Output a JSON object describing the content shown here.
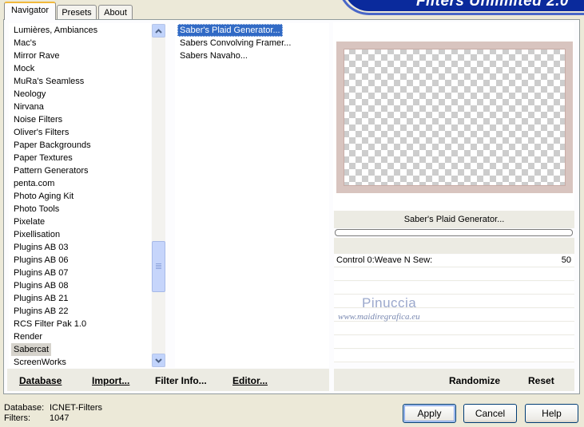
{
  "tabs": [
    {
      "label": "Navigator",
      "active": true
    },
    {
      "label": "Presets",
      "active": false
    },
    {
      "label": "About",
      "active": false
    }
  ],
  "banner": {
    "title": "Filters Unlimited 2.0"
  },
  "categories": [
    {
      "label": "Lumières, Ambiances"
    },
    {
      "label": "Mac's"
    },
    {
      "label": "Mirror Rave"
    },
    {
      "label": "Mock"
    },
    {
      "label": "MuRa's Seamless"
    },
    {
      "label": "Neology"
    },
    {
      "label": "Nirvana"
    },
    {
      "label": "Noise Filters"
    },
    {
      "label": "Oliver's Filters"
    },
    {
      "label": "Paper Backgrounds"
    },
    {
      "label": "Paper Textures"
    },
    {
      "label": "Pattern Generators"
    },
    {
      "label": "penta.com"
    },
    {
      "label": "Photo Aging Kit"
    },
    {
      "label": "Photo Tools"
    },
    {
      "label": "Pixelate"
    },
    {
      "label": "Pixellisation"
    },
    {
      "label": "Plugins AB 03"
    },
    {
      "label": "Plugins AB 06"
    },
    {
      "label": "Plugins AB 07"
    },
    {
      "label": "Plugins AB 08"
    },
    {
      "label": "Plugins AB 21"
    },
    {
      "label": "Plugins AB 22"
    },
    {
      "label": "RCS Filter Pak 1.0"
    },
    {
      "label": "Render"
    },
    {
      "label": "Sabercat",
      "selected": true
    },
    {
      "label": "ScreenWorks"
    }
  ],
  "filters": [
    {
      "label": "Saber's Plaid Generator...",
      "selected": true
    },
    {
      "label": "Sabers Convolving Framer..."
    },
    {
      "label": "Sabers Navaho..."
    }
  ],
  "preview": {
    "filter_name": "Saber's Plaid Generator...",
    "progress": 0
  },
  "controls": [
    {
      "label": "Control 0:Weave N Sew:",
      "value": "50"
    },
    {
      "label": "",
      "value": ""
    },
    {
      "label": "",
      "value": ""
    },
    {
      "label": "",
      "value": ""
    },
    {
      "label": "",
      "value": ""
    },
    {
      "label": "",
      "value": ""
    },
    {
      "label": "",
      "value": ""
    },
    {
      "label": "",
      "value": ""
    }
  ],
  "watermark": {
    "name": "Pinuccia",
    "url": "www.maidiregrafica.eu"
  },
  "toolbar": {
    "database": "Database",
    "import": "Import...",
    "filter_info": "Filter Info...",
    "editor": "Editor...",
    "randomize": "Randomize",
    "reset": "Reset"
  },
  "footer": {
    "database_label": "Database:",
    "database_value": "ICNET-Filters",
    "filters_label": "Filters:",
    "filters_value": "1047"
  },
  "buttons": {
    "apply": "Apply",
    "cancel": "Cancel",
    "help": "Help"
  },
  "colors": {
    "selection": "#316ac5",
    "frame": "#d8c4bf",
    "banner": "#0a2a9c"
  },
  "icons": {
    "scroll_up": "chevron-up-icon",
    "scroll_down": "chevron-down-icon",
    "scroll_grip": "grip-icon"
  }
}
